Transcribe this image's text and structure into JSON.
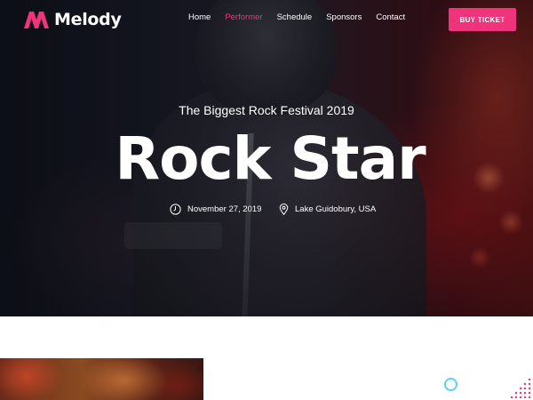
{
  "brand": {
    "name": "Melody",
    "accent_color": "#f0347b"
  },
  "nav": {
    "items": [
      {
        "label": "Home",
        "active": false
      },
      {
        "label": "Performer",
        "active": true
      },
      {
        "label": "Schedule",
        "active": false
      },
      {
        "label": "Sponsors",
        "active": false
      },
      {
        "label": "Contact",
        "active": false
      }
    ],
    "cta_label": "BUY TICKET"
  },
  "hero": {
    "subtitle": "The Biggest Rock Festival 2019",
    "headline": "Rock Star",
    "date": "November 27, 2019",
    "date_icon": "clock-icon",
    "location": "Lake Guidobury, USA",
    "location_icon": "map-pin-icon"
  },
  "decor": {
    "circle_color": "#59d4e6",
    "dots_color": "#f0347b"
  }
}
